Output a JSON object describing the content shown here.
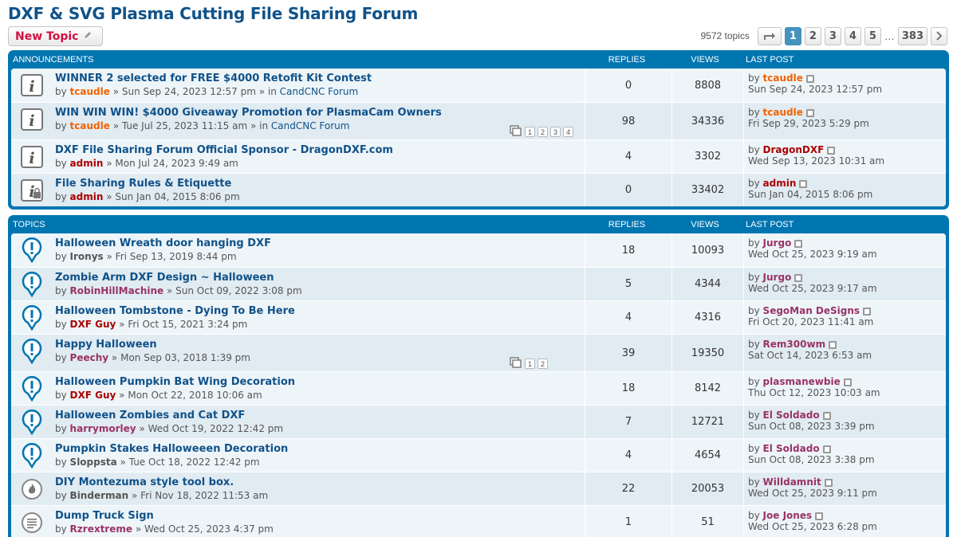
{
  "forum_title": "DXF & SVG Plasma Cutting File Sharing Forum",
  "new_topic_label": "New Topic",
  "pagination": {
    "topic_count": "9572 topics",
    "pages": [
      "1",
      "2",
      "3",
      "4",
      "5"
    ],
    "ellipsis": "…",
    "last_page": "383",
    "current": "1"
  },
  "headers": {
    "announcements": "ANNOUNCEMENTS",
    "topics": "TOPICS",
    "replies": "REPLIES",
    "views": "VIEWS",
    "last_post": "LAST POST"
  },
  "announcements": [
    {
      "title": "WINNER 2 selected for FREE $4000 Retofit Kit Contest",
      "author": "tcaudle",
      "date": "Sun Sep 24, 2023 12:57 pm",
      "location": "CandCNC Forum",
      "replies": "0",
      "views": "8808",
      "last_user": "tcaudle",
      "last_date": "Sun Sep 24, 2023 12:57 pm",
      "icon": "info-icon"
    },
    {
      "title": "WIN WIN WIN! $4000 Giveaway Promotion for PlasmaCam Owners",
      "author": "tcaudle",
      "date": "Tue Jul 25, 2023 11:15 am",
      "location": "CandCNC Forum",
      "replies": "98",
      "views": "34336",
      "last_user": "tcaudle",
      "last_date": "Fri Sep 29, 2023 5:29 pm",
      "pages": [
        "1",
        "2",
        "3",
        "4"
      ],
      "icon": "info-icon"
    },
    {
      "title": "DXF File Sharing Forum Official Sponsor - DragonDXF.com",
      "author": "admin",
      "date": "Mon Jul 24, 2023 9:49 am",
      "replies": "4",
      "views": "3302",
      "last_user": "DragonDXF",
      "last_date": "Wed Sep 13, 2023 10:31 am",
      "icon": "info-icon"
    },
    {
      "title": "File Sharing Rules & Etiquette",
      "author": "admin",
      "date": "Sun Jan 04, 2015 8:06 pm",
      "replies": "0",
      "views": "33402",
      "last_user": "admin",
      "last_date": "Sun Jan 04, 2015 8:06 pm",
      "icon": "info-locked-icon"
    }
  ],
  "topics": [
    {
      "title": "Halloween Wreath door hanging DXF",
      "author": "Ironys",
      "date": "Fri Sep 13, 2019 8:44 pm",
      "replies": "18",
      "views": "10093",
      "last_user": "Jurgo",
      "last_date": "Wed Oct 25, 2023 9:19 am",
      "icon": "alert-pin-icon"
    },
    {
      "title": "Zombie Arm DXF Design ~ Halloween",
      "author": "RobinHillMachine",
      "date": "Sun Oct 09, 2022 3:08 pm",
      "replies": "5",
      "views": "4344",
      "last_user": "Jurgo",
      "last_date": "Wed Oct 25, 2023 9:17 am",
      "icon": "alert-pin-icon"
    },
    {
      "title": "Halloween Tombstone - Dying To Be Here",
      "author": "DXF Guy",
      "date": "Fri Oct 15, 2021 3:24 pm",
      "replies": "4",
      "views": "4316",
      "last_user": "SegoMan DeSigns",
      "last_date": "Fri Oct 20, 2023 11:41 am",
      "icon": "alert-pin-icon"
    },
    {
      "title": "Happy Halloween",
      "author": "Peechy",
      "date": "Mon Sep 03, 2018 1:39 pm",
      "replies": "39",
      "views": "19350",
      "last_user": "Rem300wm",
      "last_date": "Sat Oct 14, 2023 6:53 am",
      "pages": [
        "1",
        "2"
      ],
      "icon": "alert-pin-icon"
    },
    {
      "title": "Halloween Pumpkin Bat Wing Decoration",
      "author": "DXF Guy",
      "date": "Mon Oct 22, 2018 10:06 am",
      "replies": "18",
      "views": "8142",
      "last_user": "plasmanewbie",
      "last_date": "Thu Oct 12, 2023 10:03 am",
      "icon": "alert-pin-icon"
    },
    {
      "title": "Halloween Zombies and Cat DXF",
      "author": "harrymorley",
      "date": "Wed Oct 19, 2022 12:42 pm",
      "replies": "7",
      "views": "12721",
      "last_user": "El Soldado",
      "last_date": "Sun Oct 08, 2023 3:39 pm",
      "icon": "alert-pin-icon"
    },
    {
      "title": "Pumpkin Stakes Halloweeen Decoration",
      "author": "Sloppsta",
      "date": "Tue Oct 18, 2022 12:42 pm",
      "replies": "4",
      "views": "4654",
      "last_user": "El Soldado",
      "last_date": "Sun Oct 08, 2023 3:38 pm",
      "icon": "alert-pin-icon"
    },
    {
      "title": "DIY Montezuma style tool box.",
      "author": "Binderman",
      "date": "Fri Nov 18, 2022 11:53 am",
      "replies": "22",
      "views": "20053",
      "last_user": "Willdamnit",
      "last_date": "Wed Oct 25, 2023 9:11 pm",
      "icon": "hot-topic-icon"
    },
    {
      "title": "Dump Truck Sign",
      "author": "Rzrextreme",
      "date": "Wed Oct 25, 2023 4:37 pm",
      "replies": "1",
      "views": "51",
      "last_user": "Joe Jones",
      "last_date": "Wed Oct 25, 2023 6:28 pm",
      "icon": "topic-icon"
    }
  ],
  "colors": {
    "brand": "#105289",
    "header_bg": "#0076b1",
    "moderator": "#f26300",
    "admin": "#aa0000",
    "member": "#993366"
  }
}
